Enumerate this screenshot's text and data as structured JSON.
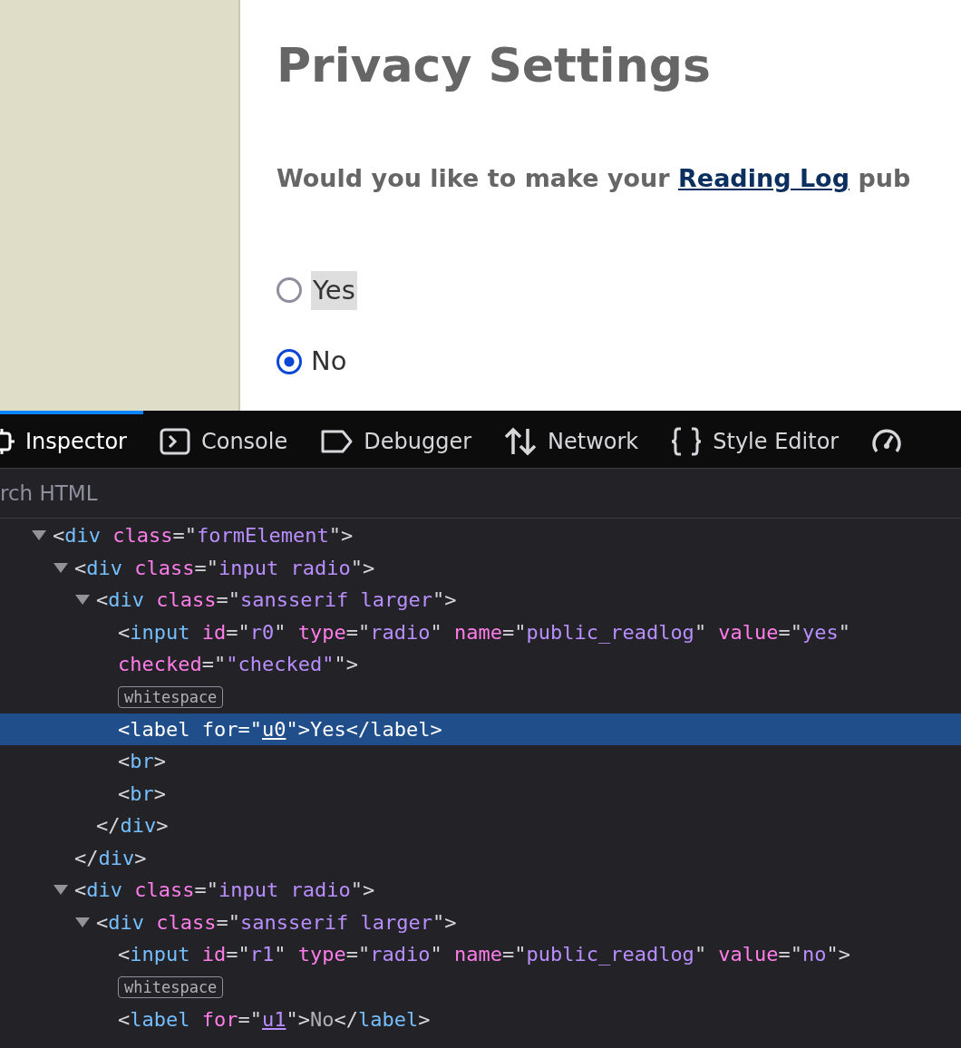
{
  "page": {
    "heading": "Privacy Settings",
    "question": [
      {
        "kind": "text",
        "text": "Would you like to make your "
      },
      {
        "kind": "link",
        "text": "Reading Log"
      },
      {
        "kind": "text",
        "text": " pub"
      }
    ],
    "options": [
      {
        "label": "Yes",
        "selected": false,
        "highlighted": true
      },
      {
        "label": "No",
        "selected": true,
        "highlighted": false
      }
    ]
  },
  "devtools": {
    "tabs": [
      {
        "label": "Inspector",
        "selected": true
      },
      {
        "label": "Console",
        "selected": false
      },
      {
        "label": "Debugger",
        "selected": false
      },
      {
        "label": "Network",
        "selected": false
      },
      {
        "label": "Style Editor",
        "selected": false
      },
      {
        "selected": false
      }
    ],
    "search": {
      "placeholder": "rch HTML"
    },
    "tree": [
      {
        "expanded": true,
        "selected": false,
        "tokens": [
          {
            "kind": "punct",
            "text": "<"
          },
          {
            "kind": "tag",
            "text": "div"
          },
          {
            "kind": "attr",
            "text": " class"
          },
          {
            "kind": "punct",
            "text": "=\""
          },
          {
            "kind": "value",
            "text": "formElement"
          },
          {
            "kind": "punct",
            "text": "\">"
          }
        ],
        "children": [
          {
            "expanded": true,
            "selected": false,
            "tokens": [
              {
                "kind": "punct",
                "text": "<"
              },
              {
                "kind": "tag",
                "text": "div"
              },
              {
                "kind": "attr",
                "text": " class"
              },
              {
                "kind": "punct",
                "text": "=\""
              },
              {
                "kind": "value",
                "text": "input radio"
              },
              {
                "kind": "punct",
                "text": "\">"
              }
            ],
            "children": [
              {
                "expanded": true,
                "selected": false,
                "tokens": [
                  {
                    "kind": "punct",
                    "text": "<"
                  },
                  {
                    "kind": "tag",
                    "text": "div"
                  },
                  {
                    "kind": "attr",
                    "text": " class"
                  },
                  {
                    "kind": "punct",
                    "text": "=\""
                  },
                  {
                    "kind": "value",
                    "text": "sansserif larger"
                  },
                  {
                    "kind": "punct",
                    "text": "\">"
                  }
                ],
                "children": [
                  {
                    "selected": false,
                    "tokens": [
                      {
                        "kind": "punct",
                        "text": "<"
                      },
                      {
                        "kind": "tag",
                        "text": "input"
                      },
                      {
                        "kind": "attr",
                        "text": " id"
                      },
                      {
                        "kind": "punct",
                        "text": "=\""
                      },
                      {
                        "kind": "value",
                        "text": "r0"
                      },
                      {
                        "kind": "punct",
                        "text": "\""
                      },
                      {
                        "kind": "attr",
                        "text": " type"
                      },
                      {
                        "kind": "punct",
                        "text": "=\""
                      },
                      {
                        "kind": "value",
                        "text": "radio"
                      },
                      {
                        "kind": "punct",
                        "text": "\""
                      },
                      {
                        "kind": "attr",
                        "text": " name"
                      },
                      {
                        "kind": "punct",
                        "text": "=\""
                      },
                      {
                        "kind": "value",
                        "text": "public_readlog"
                      },
                      {
                        "kind": "punct",
                        "text": "\""
                      },
                      {
                        "kind": "attr",
                        "text": " value"
                      },
                      {
                        "kind": "punct",
                        "text": "=\""
                      },
                      {
                        "kind": "value",
                        "text": "yes"
                      },
                      {
                        "kind": "punct",
                        "text": "\""
                      },
                      {
                        "kind": "attr",
                        "text": " checked"
                      },
                      {
                        "kind": "punct",
                        "text": "=\""
                      },
                      {
                        "kind": "value",
                        "text": "\"checked\""
                      },
                      {
                        "kind": "punct",
                        "text": "\">"
                      }
                    ]
                  },
                  {
                    "selected": false,
                    "badge": "whitespace"
                  },
                  {
                    "selected": true,
                    "tokens": [
                      {
                        "kind": "punct",
                        "text": "<"
                      },
                      {
                        "kind": "tag",
                        "text": "label"
                      },
                      {
                        "kind": "attr",
                        "text": " for"
                      },
                      {
                        "kind": "punct",
                        "text": "=\""
                      },
                      {
                        "kind": "ref",
                        "text": "u0"
                      },
                      {
                        "kind": "punct",
                        "text": "\">"
                      },
                      {
                        "kind": "content",
                        "text": "Yes"
                      },
                      {
                        "kind": "punct",
                        "text": "</"
                      },
                      {
                        "kind": "tag",
                        "text": "label"
                      },
                      {
                        "kind": "punct",
                        "text": ">"
                      }
                    ]
                  },
                  {
                    "selected": false,
                    "tokens": [
                      {
                        "kind": "punct",
                        "text": "<"
                      },
                      {
                        "kind": "tag",
                        "text": "br"
                      },
                      {
                        "kind": "punct",
                        "text": ">"
                      }
                    ]
                  },
                  {
                    "selected": false,
                    "tokens": [
                      {
                        "kind": "punct",
                        "text": "<"
                      },
                      {
                        "kind": "tag",
                        "text": "br"
                      },
                      {
                        "kind": "punct",
                        "text": ">"
                      }
                    ]
                  }
                ],
                "close": [
                  {
                    "kind": "punct",
                    "text": "</"
                  },
                  {
                    "kind": "tag",
                    "text": "div"
                  },
                  {
                    "kind": "punct",
                    "text": ">"
                  }
                ]
              }
            ],
            "close": [
              {
                "kind": "punct",
                "text": "</"
              },
              {
                "kind": "tag",
                "text": "div"
              },
              {
                "kind": "punct",
                "text": ">"
              }
            ]
          },
          {
            "expanded": true,
            "selected": false,
            "tokens": [
              {
                "kind": "punct",
                "text": "<"
              },
              {
                "kind": "tag",
                "text": "div"
              },
              {
                "kind": "attr",
                "text": " class"
              },
              {
                "kind": "punct",
                "text": "=\""
              },
              {
                "kind": "value",
                "text": "input radio"
              },
              {
                "kind": "punct",
                "text": "\">"
              }
            ],
            "children": [
              {
                "expanded": true,
                "selected": false,
                "tokens": [
                  {
                    "kind": "punct",
                    "text": "<"
                  },
                  {
                    "kind": "tag",
                    "text": "div"
                  },
                  {
                    "kind": "attr",
                    "text": " class"
                  },
                  {
                    "kind": "punct",
                    "text": "=\""
                  },
                  {
                    "kind": "value",
                    "text": "sansserif larger"
                  },
                  {
                    "kind": "punct",
                    "text": "\">"
                  }
                ],
                "children": [
                  {
                    "selected": false,
                    "tokens": [
                      {
                        "kind": "punct",
                        "text": "<"
                      },
                      {
                        "kind": "tag",
                        "text": "input"
                      },
                      {
                        "kind": "attr",
                        "text": " id"
                      },
                      {
                        "kind": "punct",
                        "text": "=\""
                      },
                      {
                        "kind": "value",
                        "text": "r1"
                      },
                      {
                        "kind": "punct",
                        "text": "\""
                      },
                      {
                        "kind": "attr",
                        "text": " type"
                      },
                      {
                        "kind": "punct",
                        "text": "=\""
                      },
                      {
                        "kind": "value",
                        "text": "radio"
                      },
                      {
                        "kind": "punct",
                        "text": "\""
                      },
                      {
                        "kind": "attr",
                        "text": " name"
                      },
                      {
                        "kind": "punct",
                        "text": "=\""
                      },
                      {
                        "kind": "value",
                        "text": "public_readlog"
                      },
                      {
                        "kind": "punct",
                        "text": "\""
                      },
                      {
                        "kind": "attr",
                        "text": " value"
                      },
                      {
                        "kind": "punct",
                        "text": "=\""
                      },
                      {
                        "kind": "value",
                        "text": "no"
                      },
                      {
                        "kind": "punct",
                        "text": "\">"
                      }
                    ]
                  },
                  {
                    "selected": false,
                    "badge": "whitespace"
                  },
                  {
                    "selected": false,
                    "tokens": [
                      {
                        "kind": "punct",
                        "text": "<"
                      },
                      {
                        "kind": "tag",
                        "text": "label"
                      },
                      {
                        "kind": "attr",
                        "text": " for"
                      },
                      {
                        "kind": "punct",
                        "text": "=\""
                      },
                      {
                        "kind": "ref",
                        "text": "u1"
                      },
                      {
                        "kind": "punct",
                        "text": "\">"
                      },
                      {
                        "kind": "content",
                        "text": "No"
                      },
                      {
                        "kind": "punct",
                        "text": "</"
                      },
                      {
                        "kind": "tag",
                        "text": "label"
                      },
                      {
                        "kind": "punct",
                        "text": ">"
                      }
                    ]
                  }
                ]
              }
            ]
          }
        ]
      }
    ]
  }
}
